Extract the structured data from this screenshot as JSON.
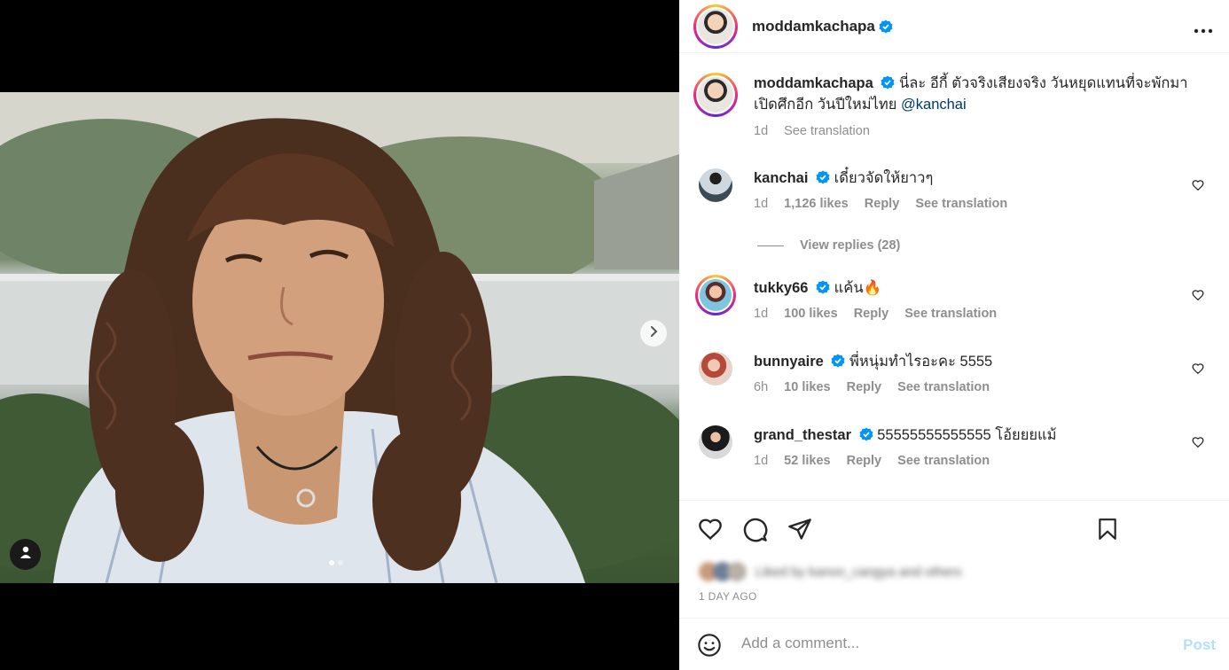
{
  "post": {
    "author": "moddamkachapa",
    "author_verified": true,
    "more_icon": "more-horizontal-icon"
  },
  "media": {
    "carousel_dots": 2,
    "active_dot": 1,
    "next_icon": "chevron-right-icon",
    "tag_icon": "user-tag-icon"
  },
  "caption": {
    "username": "moddamkachapa",
    "text": "นี่ละ อีกี้ ตัวจริงเสียงจริง วันหยุดแทนที่จะพักมา เปิดศึกอีก วันปีใหม่ไทย ",
    "mention": "@kanchai",
    "time": "1d",
    "see_translation": "See translation"
  },
  "comments": [
    {
      "username": "kanchai",
      "verified": true,
      "text": "เดี๋ยวจัดให้ยาวๆ",
      "time": "1d",
      "likes": "1,126 likes",
      "reply": "Reply",
      "see_translation": "See translation",
      "view_replies": "View replies (28)"
    },
    {
      "username": "tukky66",
      "verified": true,
      "text": "แค้น🔥",
      "time": "1d",
      "likes": "100 likes",
      "reply": "Reply",
      "see_translation": "See translation"
    },
    {
      "username": "bunnyaire",
      "verified": true,
      "text": "พี่หนุ่มทำไรอะคะ 5555",
      "time": "6h",
      "likes": "10 likes",
      "reply": "Reply",
      "see_translation": "See translation"
    },
    {
      "username": "grand_thestar",
      "verified": true,
      "text": "55555555555555 โอ้ยยยแม้",
      "time": "1d",
      "likes": "52 likes",
      "reply": "Reply",
      "see_translation": "See translation"
    }
  ],
  "actions": {
    "like_icon": "heart-icon",
    "comment_icon": "comment-bubble-icon",
    "share_icon": "send-icon",
    "save_icon": "bookmark-icon"
  },
  "likes_summary": "Liked by kanon_cangya and others",
  "time_ago": "1 DAY AGO",
  "add_comment": {
    "placeholder": "Add a comment...",
    "post_label": "Post",
    "emoji_icon": "emoji-smile-icon"
  },
  "colors": {
    "link": "#00376b",
    "verified_badge": "#0095f6",
    "post_disabled": "#b2dffc",
    "secondary_text": "#8e8e8e"
  }
}
